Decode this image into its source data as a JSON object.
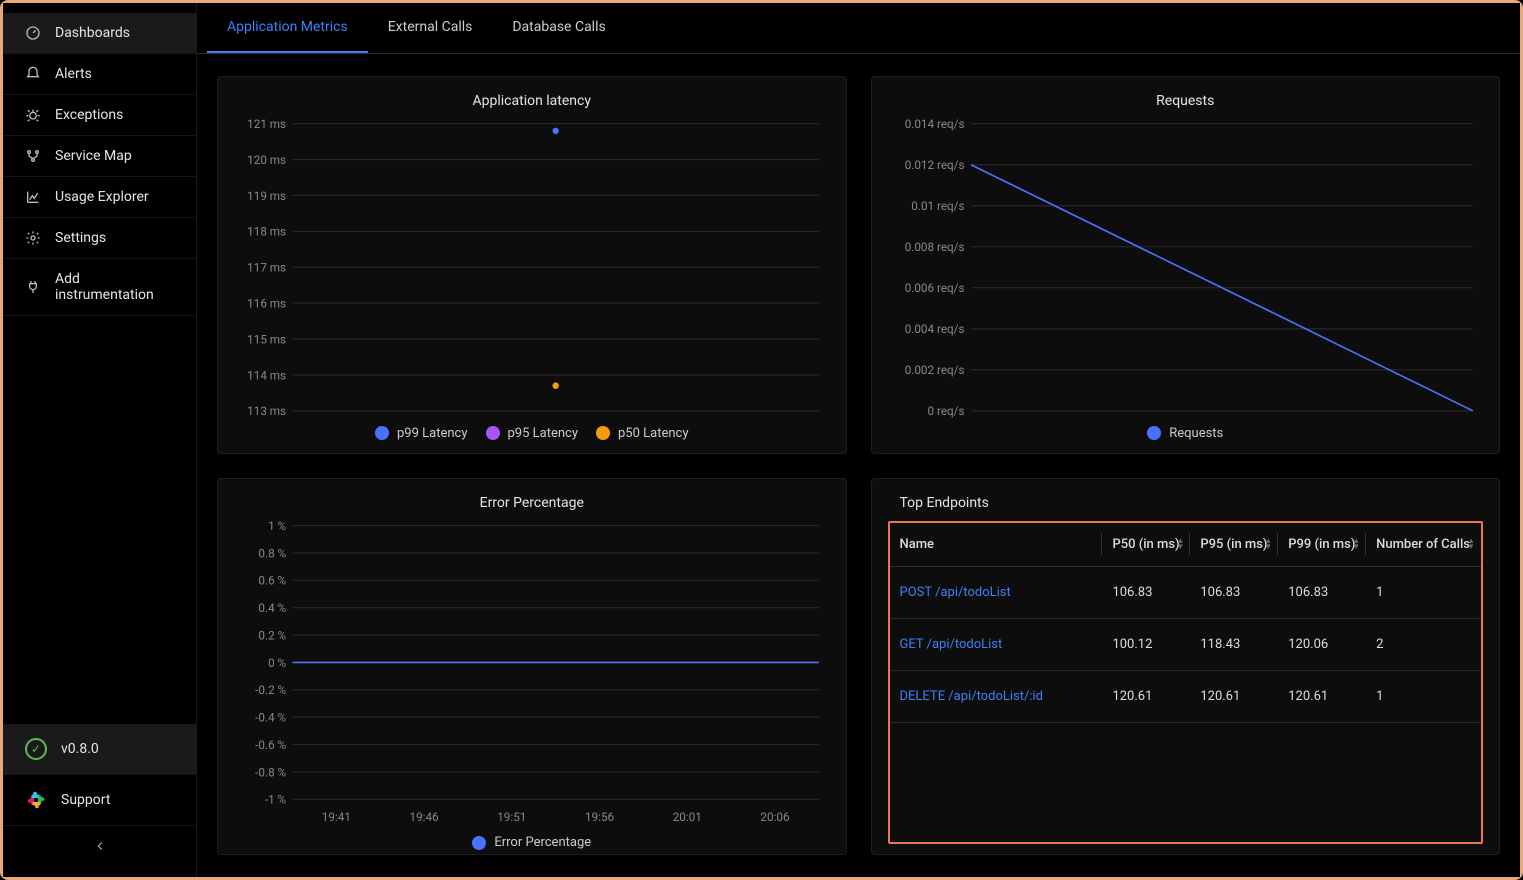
{
  "sidebar": {
    "items": [
      {
        "label": "Dashboards",
        "icon": "dashboard"
      },
      {
        "label": "Alerts",
        "icon": "alert"
      },
      {
        "label": "Exceptions",
        "icon": "bug"
      },
      {
        "label": "Service Map",
        "icon": "map"
      },
      {
        "label": "Usage Explorer",
        "icon": "chart"
      },
      {
        "label": "Settings",
        "icon": "gear"
      },
      {
        "label": "Add instrumentation",
        "icon": "plug"
      }
    ],
    "version": "v0.8.0",
    "support": "Support"
  },
  "tabs": [
    {
      "label": "Application Metrics",
      "active": true
    },
    {
      "label": "External Calls",
      "active": false
    },
    {
      "label": "Database Calls",
      "active": false
    }
  ],
  "panels": {
    "latency": {
      "title": "Application latency",
      "legend": [
        {
          "label": "p99 Latency",
          "color": "#4a72ff"
        },
        {
          "label": "p95 Latency",
          "color": "#a855f7"
        },
        {
          "label": "p50 Latency",
          "color": "#f59e0b"
        }
      ]
    },
    "requests": {
      "title": "Requests",
      "legend": [
        {
          "label": "Requests",
          "color": "#4a72ff"
        }
      ]
    },
    "error": {
      "title": "Error Percentage",
      "legend": [
        {
          "label": "Error Percentage",
          "color": "#4a72ff"
        }
      ]
    },
    "endpoints": {
      "title": "Top Endpoints",
      "columns": [
        "Name",
        "P50 (in ms)",
        "P95 (in ms)",
        "P99 (in ms)",
        "Number of Calls"
      ],
      "rows": [
        {
          "name": "POST /api/todoList",
          "p50": "106.83",
          "p95": "106.83",
          "p99": "106.83",
          "calls": "1"
        },
        {
          "name": "GET /api/todoList",
          "p50": "100.12",
          "p95": "118.43",
          "p99": "120.06",
          "calls": "2"
        },
        {
          "name": "DELETE /api/todoList/:id",
          "p50": "120.61",
          "p95": "120.61",
          "p99": "120.61",
          "calls": "1"
        }
      ]
    }
  },
  "chart_data": [
    {
      "type": "scatter",
      "title": "Application latency",
      "ylabel": "ms",
      "ylim": [
        113,
        121
      ],
      "yticks": [
        "121 ms",
        "120 ms",
        "119 ms",
        "118 ms",
        "117 ms",
        "116 ms",
        "115 ms",
        "114 ms",
        "113 ms"
      ],
      "series": [
        {
          "name": "p99 Latency",
          "color": "#4a72ff",
          "points": [
            {
              "x": 0.5,
              "y": 120.8
            }
          ]
        },
        {
          "name": "p95 Latency",
          "color": "#a855f7",
          "points": []
        },
        {
          "name": "p50 Latency",
          "color": "#f59e0b",
          "points": [
            {
              "x": 0.5,
              "y": 113.7
            }
          ]
        }
      ]
    },
    {
      "type": "line",
      "title": "Requests",
      "ylabel": "req/s",
      "ylim": [
        0,
        0.014
      ],
      "yticks": [
        "0.014 req/s",
        "0.012 req/s",
        "0.01 req/s",
        "0.008 req/s",
        "0.006 req/s",
        "0.004 req/s",
        "0.002 req/s",
        "0 req/s"
      ],
      "series": [
        {
          "name": "Requests",
          "color": "#4a72ff",
          "points": [
            {
              "x": 0,
              "y": 0.012
            },
            {
              "x": 1,
              "y": 0
            }
          ]
        }
      ]
    },
    {
      "type": "line",
      "title": "Error Percentage",
      "ylabel": "%",
      "ylim": [
        -1,
        1
      ],
      "yticks": [
        "1 %",
        "0.8 %",
        "0.6 %",
        "0.4 %",
        "0.2 %",
        "0 %",
        "-0.2 %",
        "-0.4 %",
        "-0.6 %",
        "-0.8 %",
        "-1 %"
      ],
      "xticks": [
        "19:41",
        "19:46",
        "19:51",
        "19:56",
        "20:01",
        "20:06"
      ],
      "series": [
        {
          "name": "Error Percentage",
          "color": "#4a72ff",
          "points": [
            {
              "x": 0,
              "y": 0
            },
            {
              "x": 1,
              "y": 0
            }
          ]
        }
      ]
    }
  ]
}
